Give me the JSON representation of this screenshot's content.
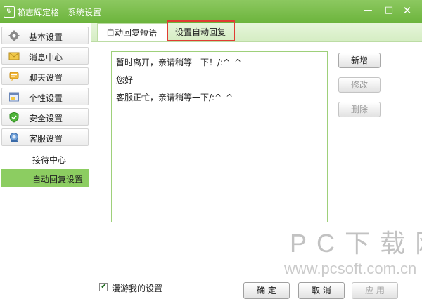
{
  "window": {
    "title": "赖志辉定格 - 系统设置",
    "app_icon_text": "Ψ",
    "minimize": "—",
    "maximize": "□",
    "close": "✕"
  },
  "sidebar": {
    "items": [
      {
        "label": "基本设置",
        "icon": "gear-icon"
      },
      {
        "label": "消息中心",
        "icon": "envelope-icon"
      },
      {
        "label": "聊天设置",
        "icon": "chat-icon"
      },
      {
        "label": "个性设置",
        "icon": "window-icon"
      },
      {
        "label": "安全设置",
        "icon": "shield-icon"
      },
      {
        "label": "客服设置",
        "icon": "service-icon"
      }
    ],
    "sub_items": [
      {
        "label": "接待中心",
        "active": false
      },
      {
        "label": "自动回复设置",
        "active": true
      }
    ]
  },
  "tabs": [
    {
      "label": "自动回复短语",
      "active": true
    },
    {
      "label": "设置自动回复",
      "active": false,
      "highlighted": true
    }
  ],
  "replies": [
    "暂时离开，亲请稍等一下！/:^_^",
    "您好",
    "客服正忙，亲请稍等一下/:^_^"
  ],
  "actions": {
    "add": "新增",
    "edit": "修改",
    "delete": "删除"
  },
  "footer": {
    "roaming_label": "漫游我的设置",
    "roaming_checked": true,
    "ok": "确 定",
    "cancel": "取 消",
    "apply": "应 用"
  },
  "watermark": {
    "main": "PC下载网",
    "url": "www.pcsoft.com.cn"
  },
  "colors": {
    "accent": "#7cbf4c",
    "highlight": "#e03c32"
  }
}
